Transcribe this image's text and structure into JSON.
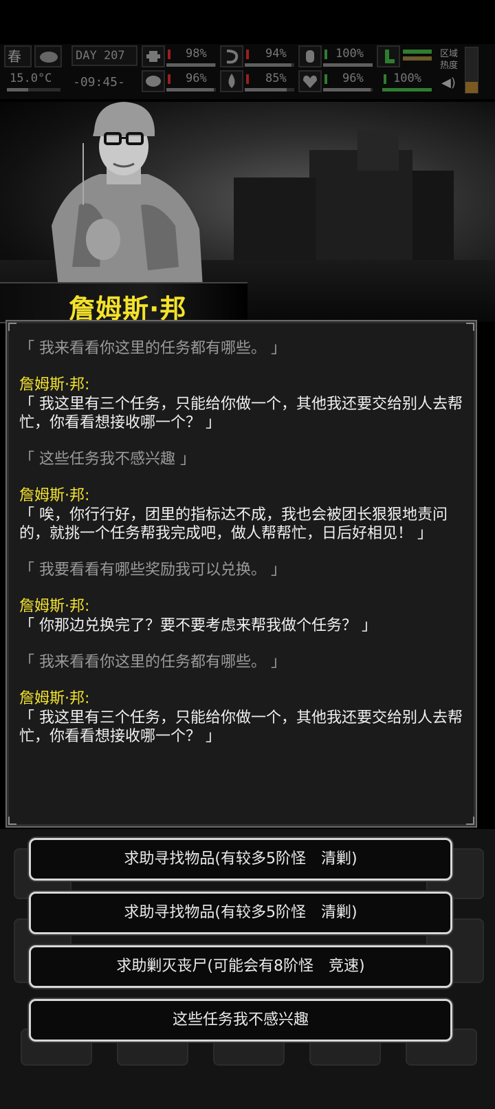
{
  "status": {
    "season": "春",
    "temperature": "15.0°C",
    "day": "DAY 207",
    "time": "-09:45-",
    "stats_row1": [
      "98%",
      "94%",
      "100%",
      "100%"
    ],
    "stats_row2": [
      "96%",
      "85%",
      "96%",
      "100%"
    ],
    "stats_row1_level": [
      0.98,
      0.94,
      1.0,
      1.0
    ],
    "stats_row2_level": [
      0.96,
      0.85,
      0.96,
      1.0
    ],
    "region_label": "区域热度"
  },
  "npc": {
    "name": "詹姆斯·邦"
  },
  "dialog": [
    {
      "type": "player",
      "text": "「 我来看看你这里的任务都有哪些。 」"
    },
    {
      "type": "npc",
      "speaker": "詹姆斯·邦:",
      "text": "「 我这里有三个任务，只能给你做一个，其他我还要交给别人去帮忙，你看看想接收哪一个？ 」"
    },
    {
      "type": "player",
      "text": "「 这些任务我不感兴趣 」"
    },
    {
      "type": "npc",
      "speaker": "詹姆斯·邦:",
      "text": "「 唉，你行行好，团里的指标达不成，我也会被团长狠狠地责问的，就挑一个任务帮我完成吧，做人帮帮忙，日后好相见！ 」"
    },
    {
      "type": "player",
      "text": "「 我要看看有哪些奖励我可以兑换。 」"
    },
    {
      "type": "npc",
      "speaker": "詹姆斯·邦:",
      "text": "「 你那边兑换完了？要不要考虑来帮我做个任务？ 」"
    },
    {
      "type": "player",
      "text": "「 我来看看你这里的任务都有哪些。 」"
    },
    {
      "type": "npc",
      "speaker": "詹姆斯·邦:",
      "text": "「 我这里有三个任务，只能给你做一个，其他我还要交给别人去帮忙，你看看想接收哪一个？ 」"
    }
  ],
  "options": [
    "求助寻找物品(有较多5阶怪　清剿)",
    "求助寻找物品(有较多5阶怪　清剿)",
    "求助剿灭丧尸(可能会有8阶怪　竞速)",
    "这些任务我不感兴趣"
  ],
  "colors": {
    "speaker": "#f3e331",
    "player_text": "#9a9a9a",
    "npc_text": "#f0f0f0"
  }
}
